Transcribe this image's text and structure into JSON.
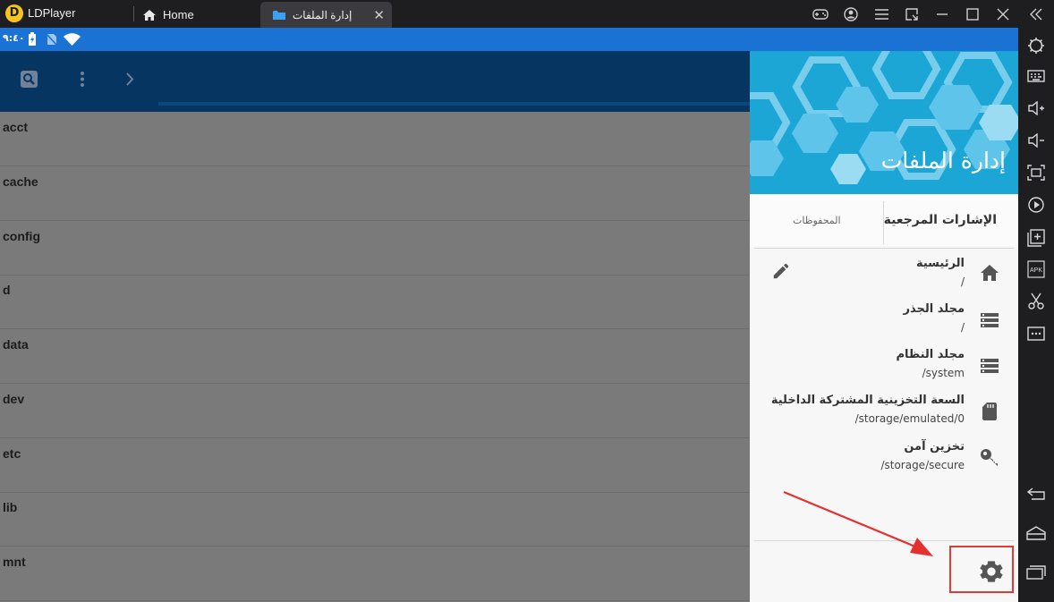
{
  "window": {
    "app_name": "LDPlayer",
    "tabs": [
      {
        "label": "Home",
        "icon": "home-icon"
      },
      {
        "label": "إدارة الملفات",
        "icon": "folder-icon",
        "active": true
      }
    ]
  },
  "status_bar": {
    "time": "٩:٤٠"
  },
  "file_list": {
    "items": [
      "acct",
      "cache",
      "config",
      "d",
      "data",
      "dev",
      "etc",
      "lib",
      "mnt"
    ]
  },
  "drawer": {
    "title": "إدارة الملفات",
    "tabs": [
      "الإشارات المرجعية",
      "المحفوظات"
    ],
    "bookmarks": [
      {
        "name": "الرئيسية",
        "path": "/",
        "icon": "home-icon"
      },
      {
        "name": "مجلد الجذر",
        "path": "/",
        "icon": "storage-icon"
      },
      {
        "name": "مجلد النظام",
        "path": "/system",
        "icon": "storage-icon"
      },
      {
        "name": "السعة التخزينية المشتركة الداخلية",
        "path": "/storage/emulated/0",
        "icon": "sd-card-icon"
      },
      {
        "name": "تخزين آمن",
        "path": "/storage/secure",
        "icon": "key-icon"
      }
    ]
  },
  "colors": {
    "titlebar": "#1e1e21",
    "statusbar": "#1a73d4",
    "appbar": "#073561",
    "drawer_header": "#1ba6d6",
    "highlight": "#e03b3b"
  }
}
